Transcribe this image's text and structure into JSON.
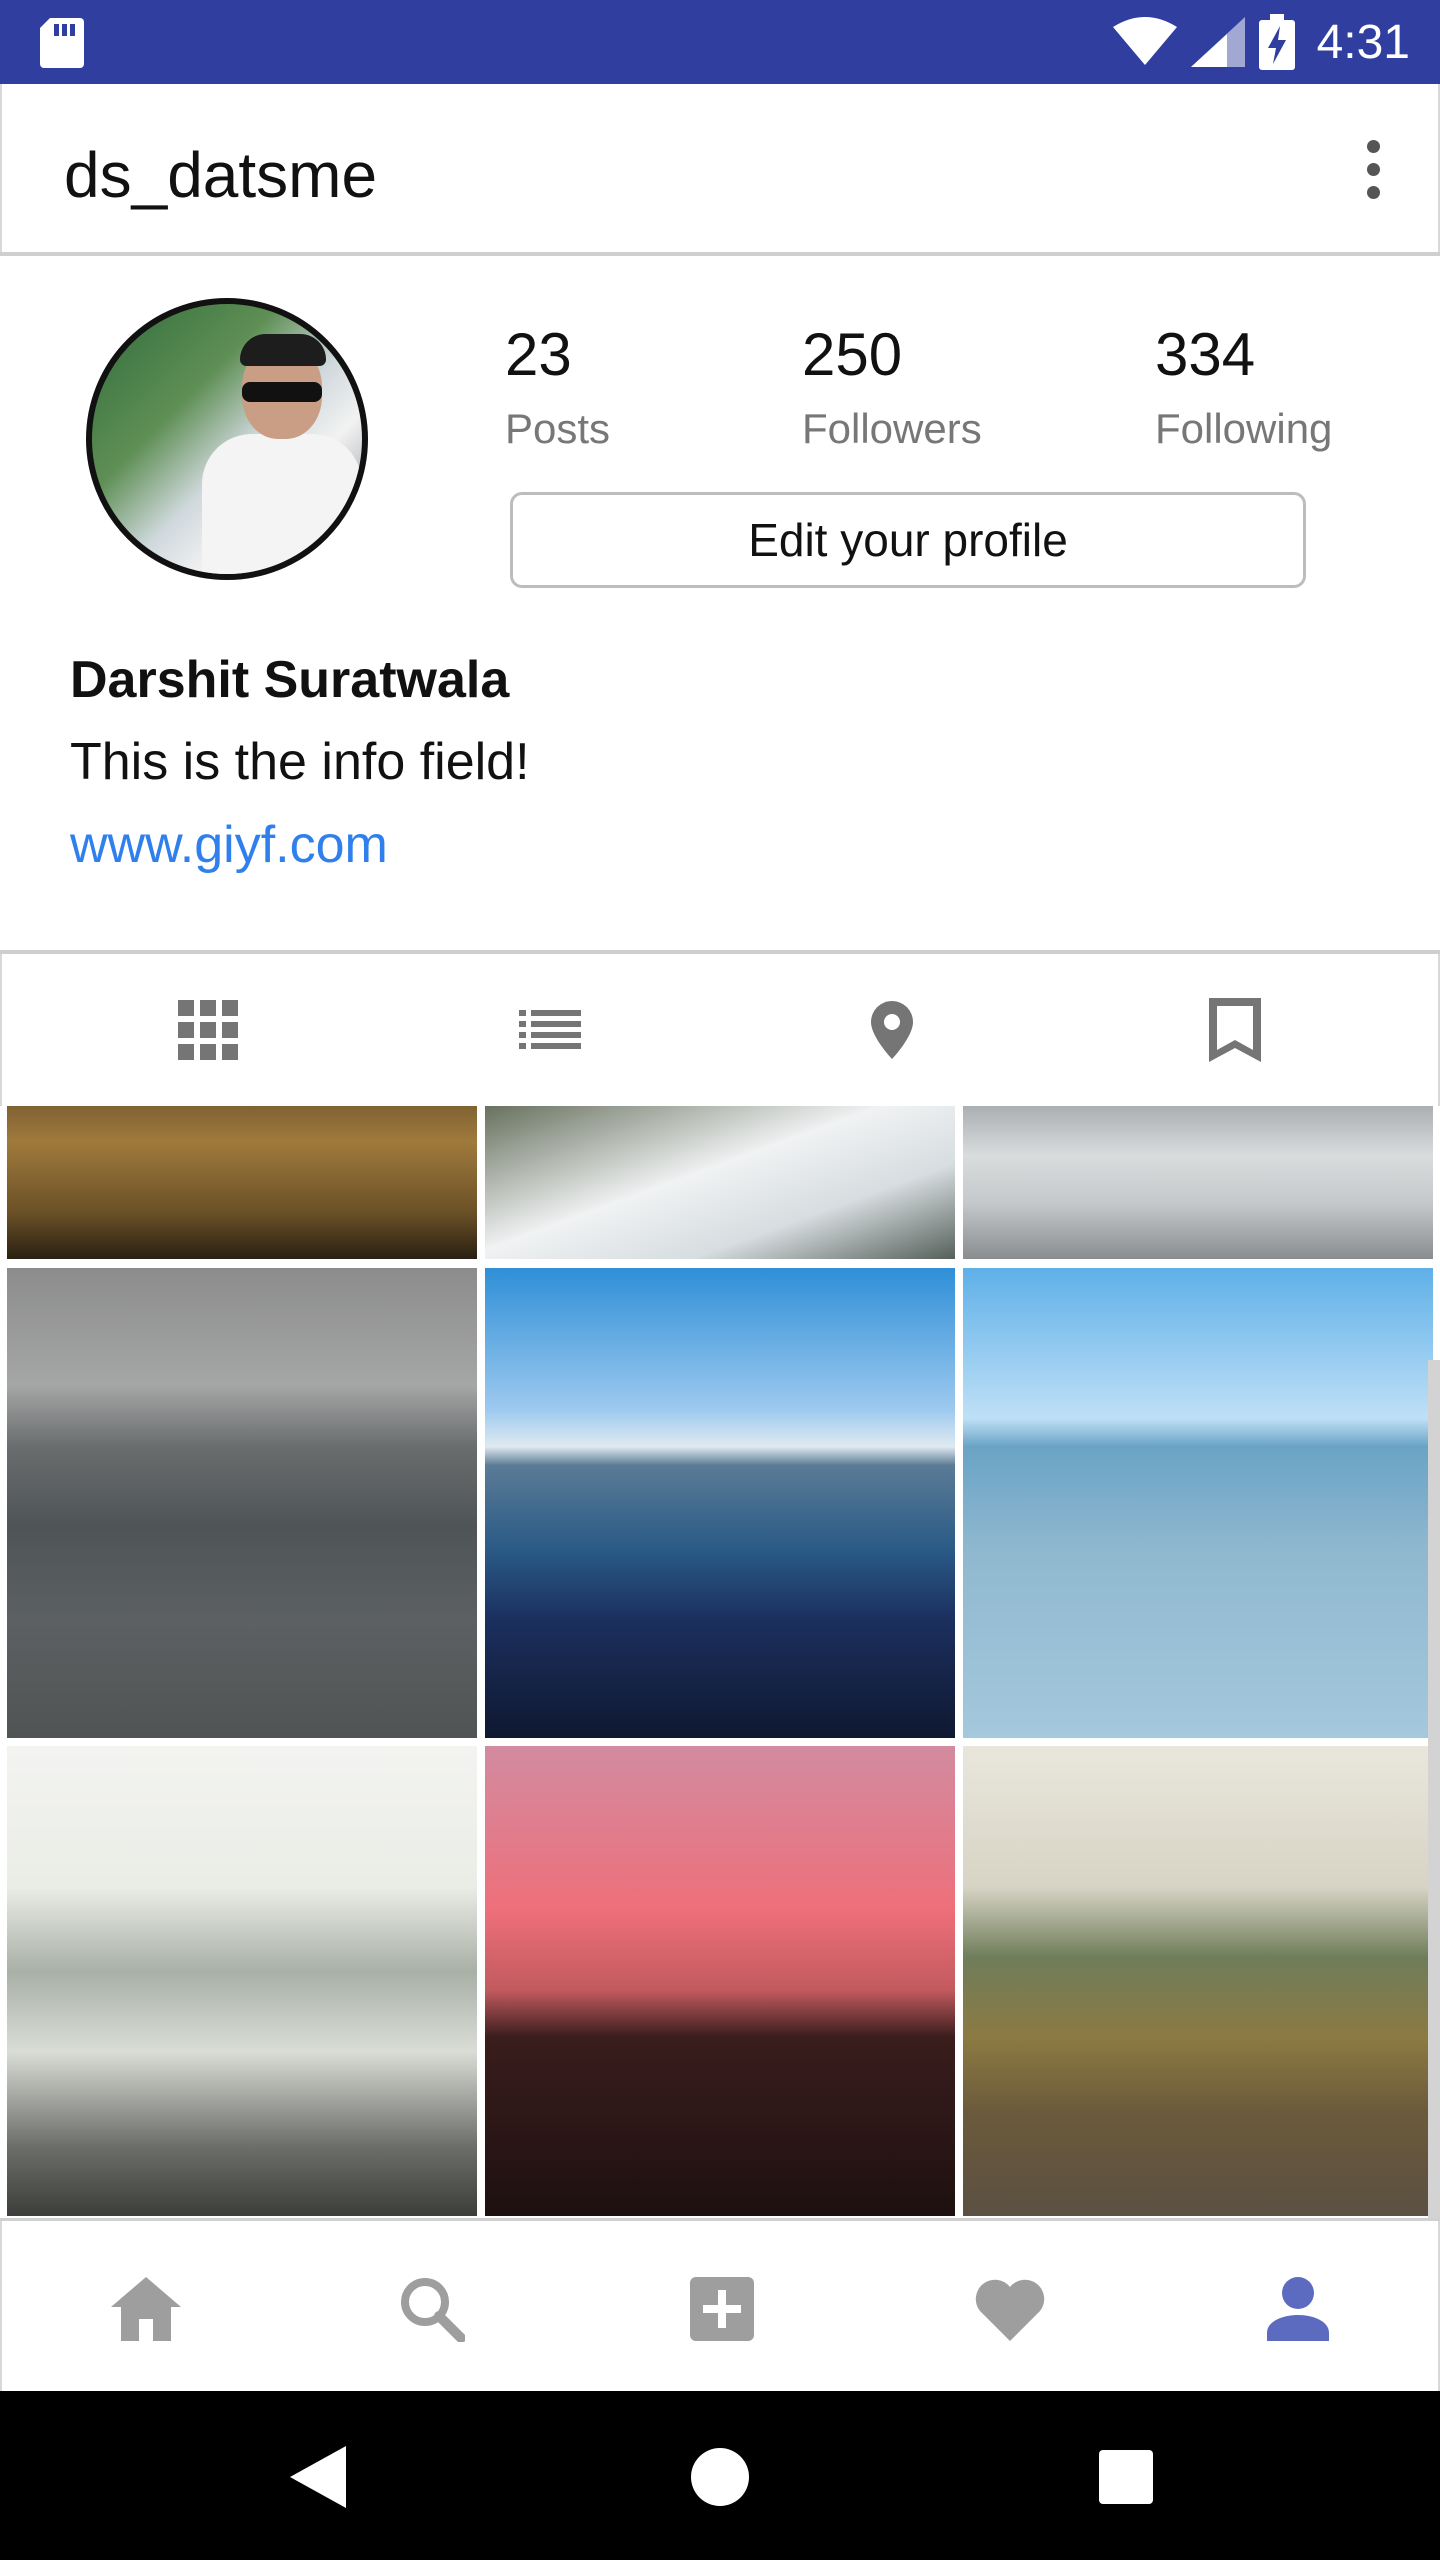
{
  "status_bar": {
    "time": "4:31",
    "icons": [
      "sd-card-icon",
      "wifi-icon",
      "signal-icon",
      "battery-charging-icon"
    ]
  },
  "toolbar": {
    "title": "ds_datsme",
    "menu_icon": "more-vert-icon"
  },
  "profile": {
    "stats": [
      {
        "value": "23",
        "label": "Posts"
      },
      {
        "value": "250",
        "label": "Followers"
      },
      {
        "value": "334",
        "label": "Following"
      }
    ],
    "edit_button": "Edit your profile",
    "name": "Darshit Suratwala",
    "bio": "This is the info field!",
    "website": "www.giyf.com"
  },
  "view_tabs": [
    "grid-icon",
    "list-icon",
    "location-icon",
    "bookmark-icon"
  ],
  "bottom_nav": {
    "items": [
      "home-icon",
      "search-icon",
      "add-box-icon",
      "heart-icon",
      "person-icon"
    ],
    "active": "person-icon",
    "active_color": "#5c6bc0",
    "inactive_color": "#9e9e9e"
  },
  "colors": {
    "status_bar": "#303f9f",
    "link": "#2f80ed",
    "system_nav": "#000000"
  },
  "system_nav": [
    "back-icon",
    "home-circle-icon",
    "recents-icon"
  ]
}
